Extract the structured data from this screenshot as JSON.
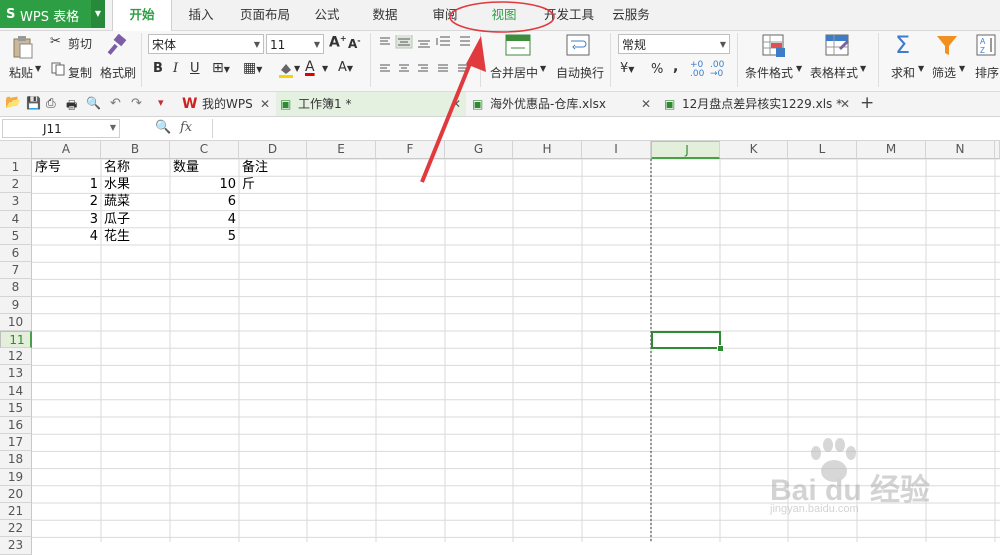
{
  "app": {
    "logo": "S",
    "name": "WPS 表格"
  },
  "menu_tabs": [
    "开始",
    "插入",
    "页面布局",
    "公式",
    "数据",
    "审阅",
    "视图",
    "开发工具",
    "云服务"
  ],
  "ribbon": {
    "paste": "粘贴",
    "cut": "剪切",
    "copy": "复制",
    "format_painter": "格式刷",
    "font_name": "宋体",
    "font_size": "11",
    "merge_center": "合并居中",
    "wrap_text": "自动换行",
    "number_format": "常规",
    "percent": "%",
    "comma": ",",
    "conditional_format": "条件格式",
    "table_style": "表格样式",
    "sum": "求和",
    "filter": "筛选",
    "sort": "排序"
  },
  "doc_tabs": [
    {
      "label": "我的WPS"
    },
    {
      "label": "工作簿1 *"
    },
    {
      "label": "海外优惠品-仓库.xlsx"
    },
    {
      "label": "12月盘点差异核实1229.xls *"
    }
  ],
  "formula_bar": {
    "cell_ref": "J11",
    "fx": "fx",
    "value": ""
  },
  "columns": [
    "A",
    "B",
    "C",
    "D",
    "E",
    "F",
    "G",
    "H",
    "I",
    "J",
    "K",
    "L",
    "M",
    "N"
  ],
  "rows": [
    "1",
    "2",
    "3",
    "4",
    "5",
    "6",
    "7",
    "8",
    "9",
    "10",
    "11",
    "12",
    "13",
    "14",
    "15",
    "16",
    "17",
    "18",
    "19",
    "20",
    "21",
    "22",
    "23"
  ],
  "active_cell": "J11",
  "cells": {
    "A1": "序号",
    "B1": "名称",
    "C1": "数量",
    "D1": "备注",
    "A2": "1",
    "B2": "水果",
    "C2": "10",
    "D2": "斤",
    "A3": "2",
    "B3": "蔬菜",
    "C3": "6",
    "A4": "3",
    "B4": "瓜子",
    "C4": "4",
    "A5": "4",
    "B5": "花生",
    "C5": "5"
  },
  "annotation": {
    "highlight_tab": "视图"
  },
  "watermark": {
    "brand": "Bai du 经验",
    "url": "jingyan.baidu.com"
  },
  "colors": {
    "accent": "#2e9e44",
    "annotation": "#e0393e"
  }
}
